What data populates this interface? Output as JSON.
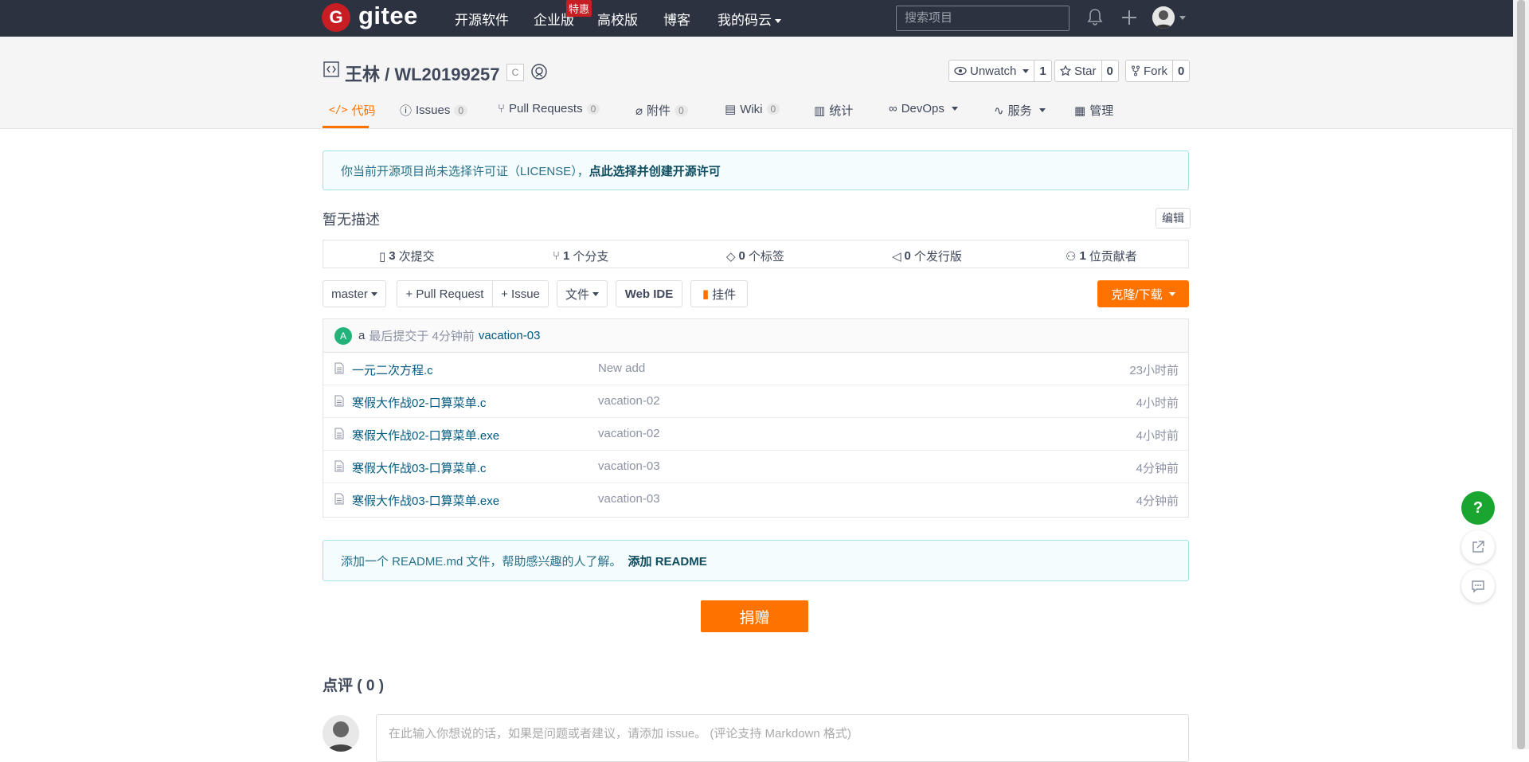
{
  "navbar": {
    "logo_letter": "G",
    "logo_text": "gitee",
    "items": [
      {
        "label": "开源软件"
      },
      {
        "label": "企业版"
      },
      {
        "label": "高校版"
      },
      {
        "label": "博客"
      },
      {
        "label": "我的码云"
      }
    ],
    "enterprise_badge": "特惠",
    "search_placeholder": "搜索项目",
    "icons": [
      "bell-icon",
      "plus-icon",
      "user-avatar"
    ]
  },
  "repo": {
    "title": "王林 / WL20199257",
    "language_tag": "C",
    "watch": {
      "label": "Unwatch",
      "count": "1"
    },
    "star": {
      "label": "Star",
      "count": "0"
    },
    "fork": {
      "label": "Fork",
      "count": "0"
    }
  },
  "tabs": [
    {
      "label": "代码",
      "count": null
    },
    {
      "label": "Issues",
      "count": "0"
    },
    {
      "label": "Pull Requests",
      "count": "0"
    },
    {
      "label": "附件",
      "count": "0"
    },
    {
      "label": "Wiki",
      "count": "0"
    },
    {
      "label": "统计",
      "count": null
    },
    {
      "label": "DevOps",
      "count": null
    },
    {
      "label": "服务",
      "count": null
    },
    {
      "label": "管理",
      "count": null
    }
  ],
  "license_notice": {
    "text": "你当前开源项目尚未选择许可证（LICENSE），",
    "link": "点此选择并创建开源许可"
  },
  "description": "暂无描述",
  "edit_label": "编辑",
  "stats": [
    {
      "count": "3",
      "label": "次提交"
    },
    {
      "count": "1",
      "label": "个分支"
    },
    {
      "count": "0",
      "label": "个标签"
    },
    {
      "count": "0",
      "label": "个发行版"
    },
    {
      "count": "1",
      "label": "位贡献者"
    }
  ],
  "toolbar": {
    "branch": "master",
    "pull_request": "+ Pull Request",
    "issue": "+ Issue",
    "file": "文件",
    "web_ide": "Web IDE",
    "widget": "挂件",
    "clone": "克隆/下载"
  },
  "last_commit": {
    "avatar_letter": "A",
    "author": "a",
    "text": "最后提交于 4分钟前",
    "message": "vacation-03"
  },
  "files": [
    {
      "name": "一元二次方程.c",
      "message": "New add",
      "time": "23小时前"
    },
    {
      "name": "寒假大作战02-口算菜单.c",
      "message": "vacation-02",
      "time": "4小时前"
    },
    {
      "name": "寒假大作战02-口算菜单.exe",
      "message": "vacation-02",
      "time": "4小时前"
    },
    {
      "name": "寒假大作战03-口算菜单.c",
      "message": "vacation-03",
      "time": "4分钟前"
    },
    {
      "name": "寒假大作战03-口算菜单.exe",
      "message": "vacation-03",
      "time": "4分钟前"
    }
  ],
  "readme_notice": {
    "text": "添加一个 README.md 文件，帮助感兴趣的人了解。",
    "link": "添加 README"
  },
  "donate_label": "捐赠",
  "comments": {
    "title": "点评 ( 0 )",
    "placeholder": "在此输入你想说的话，如果是问题或者建议，请添加 issue。 (评论支持 Markdown 格式)"
  },
  "float_buttons": {
    "help": "?"
  },
  "colors": {
    "navbar": "#2c3240",
    "accent": "#fe7300",
    "brand": "#c71d23",
    "link": "#005980"
  }
}
